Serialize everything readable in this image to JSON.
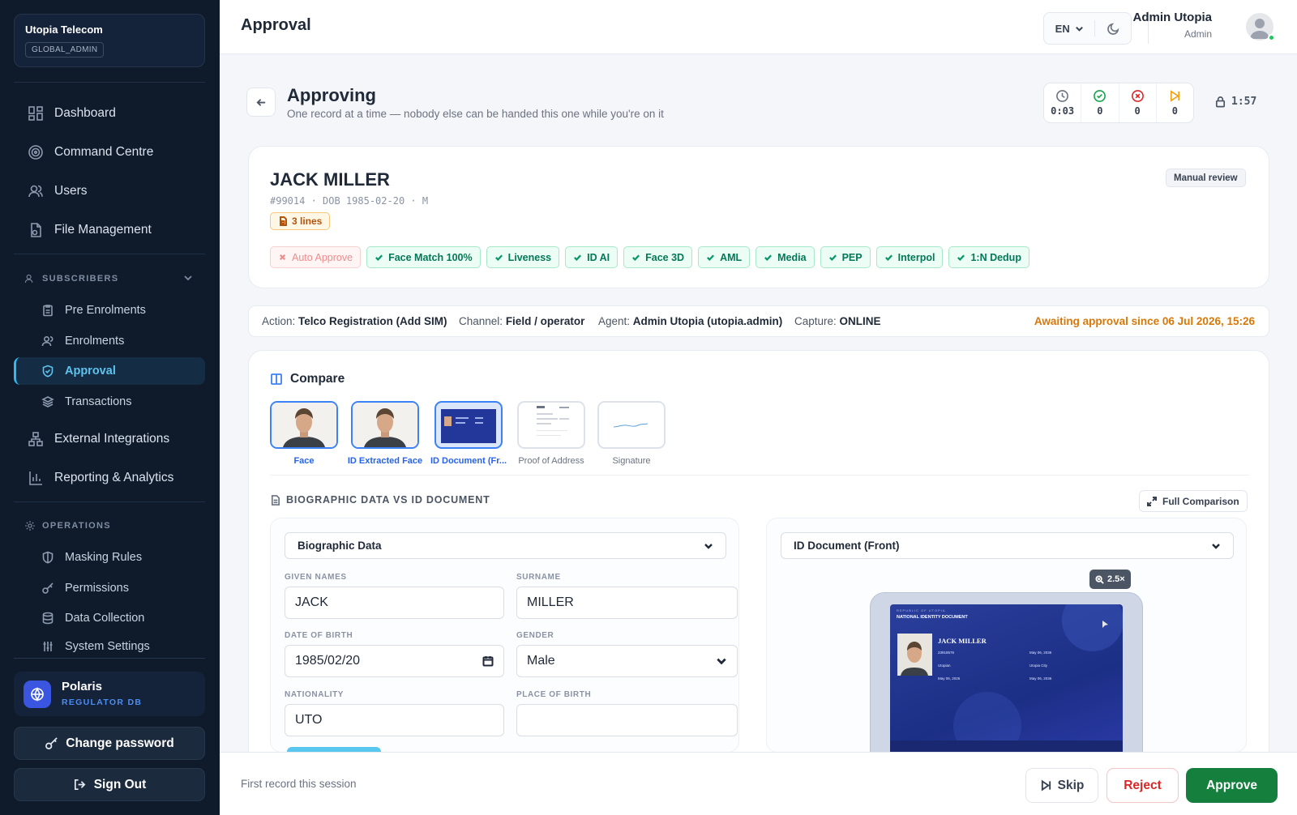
{
  "org": {
    "name": "Utopia Telecom",
    "role": "GLOBAL_ADMIN"
  },
  "nav": {
    "dashboard": "Dashboard",
    "command_centre": "Command Centre",
    "users": "Users",
    "file_management": "File Management",
    "subscribers_section": "SUBSCRIBERS",
    "pre_enrolments": "Pre Enrolments",
    "enrolments": "Enrolments",
    "approval": "Approval",
    "transactions": "Transactions",
    "external_integrations": "External Integrations",
    "reporting_analytics": "Reporting & Analytics",
    "operations_section": "OPERATIONS",
    "masking_rules": "Masking Rules",
    "permissions": "Permissions",
    "data_collection": "Data Collection",
    "system_settings": "System Settings"
  },
  "product": {
    "name": "Polaris",
    "subtitle": "REGULATOR DB"
  },
  "sidebar_buttons": {
    "change_password": "Change password",
    "sign_out": "Sign Out"
  },
  "header": {
    "title": "Approval",
    "language": "EN",
    "user_name": "Admin Utopia",
    "user_role": "Admin"
  },
  "page": {
    "title": "Approving",
    "subtitle": "One record at a time — nobody else can be handed this one while you're on it"
  },
  "stats": {
    "timer": "0:03",
    "approved": "0",
    "rejected": "0",
    "skipped": "0",
    "lock_timer": "1:57"
  },
  "record": {
    "name": "JACK MILLER",
    "meta": "#99014 · DOB 1985-02-20 · M",
    "lines_badge": "3 lines",
    "review_badge": "Manual review",
    "checks": [
      {
        "label": "Auto Approve",
        "status": "fail"
      },
      {
        "label": "Face Match 100%",
        "status": "pass"
      },
      {
        "label": "Liveness",
        "status": "pass"
      },
      {
        "label": "ID AI",
        "status": "pass"
      },
      {
        "label": "Face 3D",
        "status": "pass"
      },
      {
        "label": "AML",
        "status": "pass"
      },
      {
        "label": "Media",
        "status": "pass"
      },
      {
        "label": "PEP",
        "status": "pass"
      },
      {
        "label": "Interpol",
        "status": "pass"
      },
      {
        "label": "1:N Dedup",
        "status": "pass"
      }
    ]
  },
  "info": {
    "action_label": "Action:",
    "action_value": "Telco Registration (Add SIM)",
    "channel_label": "Channel:",
    "channel_value": "Field / operator",
    "agent_label": "Agent:",
    "agent_value": "Admin Utopia (utopia.admin)",
    "capture_label": "Capture:",
    "capture_value": "ONLINE",
    "awaiting": "Awaiting approval since 06 Jul 2026, 15:26"
  },
  "compare": {
    "title": "Compare",
    "thumbs": [
      "Face",
      "ID Extracted Face",
      "ID Document (Fr...",
      "Proof of Address",
      "Signature"
    ]
  },
  "bio": {
    "title": "BIOGRAPHIC DATA VS ID DOCUMENT",
    "full_comparison": "Full Comparison",
    "left_select": "Biographic Data",
    "right_select": "ID Document (Front)",
    "zoom": "2.5×",
    "given_names_label": "GIVEN NAMES",
    "given_names": "JACK",
    "surname_label": "SURNAME",
    "surname": "MILLER",
    "dob_label": "DATE OF BIRTH",
    "dob": "1985/02/20",
    "gender_label": "GENDER",
    "gender": "Male",
    "nationality_label": "NATIONALITY",
    "nationality": "UTO",
    "pob_label": "PLACE OF BIRTH",
    "pob": ""
  },
  "id_card": {
    "country": "REPUBLIC OF UTOPIA",
    "doc_title": "NATIONAL IDENTITY DOCUMENT",
    "name": "JACK MILLER",
    "id_no": "23918576",
    "nationality": "Utopian",
    "place": "Utopia City",
    "issue": "May 06, 2026",
    "expiry": "May 06, 2036"
  },
  "footer": {
    "status": "First record this session",
    "skip": "Skip",
    "reject": "Reject",
    "approve": "Approve"
  },
  "colors": {
    "accent": "#38b6ee",
    "approve": "#15803d",
    "reject": "#dc2626",
    "warning": "#d97706",
    "sidebar_bg": "#0f1b2b"
  }
}
